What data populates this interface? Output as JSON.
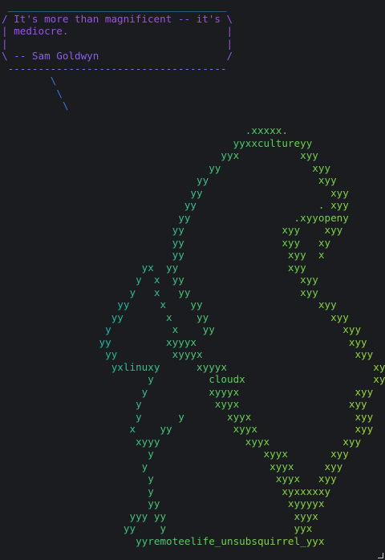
{
  "terminal": {
    "quote": {
      "text_top": " ____________________________________",
      "line1": "/ It's more than magnificent -- it's \\",
      "line2": "| mediocre.                          |",
      "line3": "|                                    |",
      "line4": "\\ -- Sam Goldwyn                     /",
      "text_bottom": " ------------------------------------"
    },
    "art_lines": [
      "        \\",
      "         \\",
      "          \\",
      "",
      "                                        .xxxxx.",
      "                                      yyxxcultureyy",
      "                                    yyx          xyy",
      "                                  yy               xyy",
      "                                yy                  xyy",
      "                               yy                     xyy",
      "                              yy                    . xyy",
      "                             yy                 .xyyopeny",
      "                            yy                xyy    xyy",
      "                            yy                xyy   xy",
      "                            yy                 xyy  x",
      "                       yx  yy                  xyy",
      "                      y  x  yy                   xyy",
      "                     y   x   yy                  xyy",
      "                   yy     x    yy                   xyy",
      "                  yy       x    yy                    xyy",
      "                 y          x    yy                     xyy",
      "                yy         xyyyx                         xyy",
      "                 yy         xyyyx                         xyy",
      "                  yxlinuxy      xyyyx                        xyy",
      "                        y         cloudx                     xyy",
      "                       y          xyyyx                   xyy",
      "                      y            xyyx                  xyy",
      "                      y      y       xyyx                 xyy",
      "                     x    yy          xyyx                xyy",
      "                      xyyy              xyyx            xyy",
      "                        y                  xyyx       xyy",
      "                       y                    xyyx     xyy",
      "                        y                    xyyx   xyy",
      "                        y                     xyxxxxxy",
      "                        yy                     xyyyyx",
      "                     yyy yy                     xyyx",
      "                    yy    y                     yyx",
      "                      yyremoteelife_unsubsquirrel_yyx"
    ],
    "colors": {
      "quote_border": "#3aa0e8",
      "quote_text": "#b24fe0",
      "art_blue": "#2f8fd6",
      "art_teal": "#20b9a4",
      "art_green": "#6cd04a",
      "art_lime": "#a8d92a",
      "background": "#1b1c1f"
    }
  }
}
